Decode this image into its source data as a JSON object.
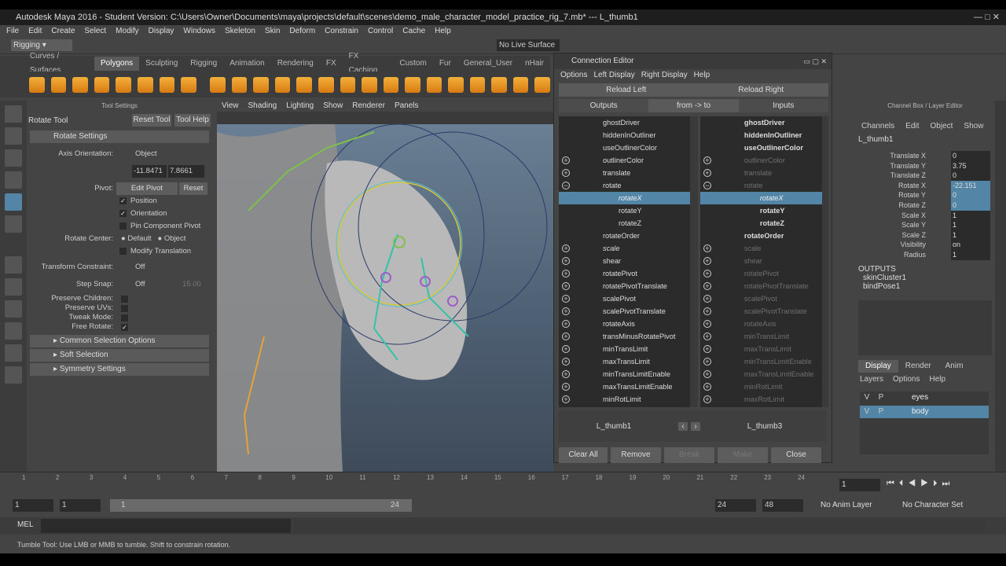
{
  "window": {
    "title": "Autodesk Maya 2016 - Student Version: C:\\Users\\Owner\\Documents\\maya\\projects\\default\\scenes\\demo_male_character_model_practice_rig_7.mb*   ---   L_thumb1"
  },
  "menus": [
    "File",
    "Edit",
    "Create",
    "Select",
    "Modify",
    "Display",
    "Windows",
    "Skeleton",
    "Skin",
    "Deform",
    "Constrain",
    "Control",
    "Cache",
    "Help"
  ],
  "status": {
    "mode": "Rigging",
    "live_surface": "No Live Surface"
  },
  "shelf_tabs": [
    "Curves / Surfaces",
    "Polygons",
    "Sculpting",
    "Rigging",
    "Animation",
    "Rendering",
    "FX",
    "FX Caching",
    "Custom",
    "Fur",
    "General_User",
    "nHair"
  ],
  "shelf_active": "Polygons",
  "tool_settings": {
    "header": "Tool Settings",
    "tool_name": "Rotate Tool",
    "reset": "Reset Tool",
    "help": "Tool Help",
    "section_rotate": "Rotate Settings",
    "axis_orientation_label": "Axis Orientation:",
    "axis_orientation": "Object",
    "val1": "-11.8471",
    "val2": "7.8661",
    "pivot_label": "Pivot:",
    "edit_pivot": "Edit Pivot",
    "reset_pivot": "Reset",
    "position": "Position",
    "orientation": "Orientation",
    "pin": "Pin Component Pivot",
    "rotate_center_label": "Rotate Center:",
    "rc_default": "Default",
    "rc_object": "Object",
    "modify_translation": "Modify Translation",
    "transform_constraint_label": "Transform Constraint:",
    "transform_constraint": "Off",
    "step_snap_label": "Step Snap:",
    "step_snap": "Off",
    "step_value": "15.00",
    "preserve_children": "Preserve Children:",
    "preserve_uvs": "Preserve UVs:",
    "tweak_mode": "Tweak Mode:",
    "free_rotate": "Free Rotate:",
    "sections": [
      "Common Selection Options",
      "Soft Selection",
      "Symmetry Settings"
    ]
  },
  "viewport": {
    "menus": [
      "View",
      "Shading",
      "Lighting",
      "Show",
      "Renderer",
      "Panels"
    ]
  },
  "connection_editor": {
    "title": "Connection Editor",
    "menus": [
      "Options",
      "Left Display",
      "Right Display",
      "Help"
    ],
    "reload_left": "Reload Left",
    "reload_right": "Reload Right",
    "outputs": "Outputs",
    "direction": "from -> to",
    "inputs": "Inputs",
    "left": [
      {
        "label": "ghostDriver",
        "indent": 1,
        "style": ""
      },
      {
        "label": "hiddenInOutliner",
        "indent": 1,
        "style": ""
      },
      {
        "label": "useOutlinerColor",
        "indent": 1,
        "style": ""
      },
      {
        "label": "outlinerColor",
        "indent": 1,
        "style": "",
        "icon": "+"
      },
      {
        "label": "translate",
        "indent": 1,
        "style": "",
        "icon": "+"
      },
      {
        "label": "rotate",
        "indent": 1,
        "style": "",
        "icon": "-"
      },
      {
        "label": "rotateX",
        "indent": 2,
        "style": "sel"
      },
      {
        "label": "rotateY",
        "indent": 2,
        "style": ""
      },
      {
        "label": "rotateZ",
        "indent": 2,
        "style": ""
      },
      {
        "label": "rotateOrder",
        "indent": 1,
        "style": ""
      },
      {
        "label": "scale",
        "indent": 1,
        "style": "it",
        "icon": "+"
      },
      {
        "label": "shear",
        "indent": 1,
        "style": "",
        "icon": "+"
      },
      {
        "label": "rotatePivot",
        "indent": 1,
        "style": "",
        "icon": "+"
      },
      {
        "label": "rotatePivotTranslate",
        "indent": 1,
        "style": "",
        "icon": "+"
      },
      {
        "label": "scalePivot",
        "indent": 1,
        "style": "",
        "icon": "+"
      },
      {
        "label": "scalePivotTranslate",
        "indent": 1,
        "style": "",
        "icon": "+"
      },
      {
        "label": "rotateAxis",
        "indent": 1,
        "style": "",
        "icon": "+"
      },
      {
        "label": "transMinusRotatePivot",
        "indent": 1,
        "style": "",
        "icon": "+"
      },
      {
        "label": "minTransLimit",
        "indent": 1,
        "style": "",
        "icon": "+"
      },
      {
        "label": "maxTransLimit",
        "indent": 1,
        "style": "",
        "icon": "+"
      },
      {
        "label": "minTransLimitEnable",
        "indent": 1,
        "style": "",
        "icon": "+"
      },
      {
        "label": "maxTransLimitEnable",
        "indent": 1,
        "style": "",
        "icon": "+"
      },
      {
        "label": "minRotLimit",
        "indent": 1,
        "style": "",
        "icon": "+"
      }
    ],
    "right": [
      {
        "label": "ghostDriver",
        "indent": 1,
        "style": "b"
      },
      {
        "label": "hiddenInOutliner",
        "indent": 1,
        "style": "b"
      },
      {
        "label": "useOutlinerColor",
        "indent": 1,
        "style": "b"
      },
      {
        "label": "outlinerColor",
        "indent": 1,
        "style": "dim",
        "icon": "+"
      },
      {
        "label": "translate",
        "indent": 1,
        "style": "dim",
        "icon": "+"
      },
      {
        "label": "rotate",
        "indent": 1,
        "style": "dim",
        "icon": "-"
      },
      {
        "label": "rotateX",
        "indent": 2,
        "style": "sel"
      },
      {
        "label": "rotateY",
        "indent": 2,
        "style": "b"
      },
      {
        "label": "rotateZ",
        "indent": 2,
        "style": "b"
      },
      {
        "label": "rotateOrder",
        "indent": 1,
        "style": "b"
      },
      {
        "label": "scale",
        "indent": 1,
        "style": "dim",
        "icon": "+"
      },
      {
        "label": "shear",
        "indent": 1,
        "style": "dim",
        "icon": "+"
      },
      {
        "label": "rotatePivot",
        "indent": 1,
        "style": "dim",
        "icon": "+"
      },
      {
        "label": "rotatePivotTranslate",
        "indent": 1,
        "style": "dim",
        "icon": "+"
      },
      {
        "label": "scalePivot",
        "indent": 1,
        "style": "dim",
        "icon": "+"
      },
      {
        "label": "scalePivotTranslate",
        "indent": 1,
        "style": "dim",
        "icon": "+"
      },
      {
        "label": "rotateAxis",
        "indent": 1,
        "style": "dim",
        "icon": "+"
      },
      {
        "label": "minTransLimit",
        "indent": 1,
        "style": "dim",
        "icon": "+"
      },
      {
        "label": "maxTransLimit",
        "indent": 1,
        "style": "dim",
        "icon": "+"
      },
      {
        "label": "minTransLimitEnable",
        "indent": 1,
        "style": "dim",
        "icon": "+"
      },
      {
        "label": "maxTransLimitEnable",
        "indent": 1,
        "style": "dim",
        "icon": "+"
      },
      {
        "label": "minRotLimit",
        "indent": 1,
        "style": "dim",
        "icon": "+"
      },
      {
        "label": "maxRotLimit",
        "indent": 1,
        "style": "dim",
        "icon": "+"
      }
    ],
    "left_node": "L_thumb1",
    "right_node": "L_thumb3",
    "buttons": {
      "clear": "Clear All",
      "remove": "Remove",
      "break": "Break",
      "make": "Make",
      "close": "Close"
    }
  },
  "channel_box": {
    "header": "Channel Box / Layer Editor",
    "menus": [
      "Channels",
      "Edit",
      "Object",
      "Show"
    ],
    "object": "L_thumb1",
    "attrs": [
      {
        "k": "Translate X",
        "v": "0",
        "hl": false
      },
      {
        "k": "Translate Y",
        "v": "3.75",
        "hl": false
      },
      {
        "k": "Translate Z",
        "v": "0",
        "hl": false
      },
      {
        "k": "Rotate X",
        "v": "-22.151",
        "hl": true
      },
      {
        "k": "Rotate Y",
        "v": "0",
        "hl": true
      },
      {
        "k": "Rotate Z",
        "v": "0",
        "hl": true
      },
      {
        "k": "Scale X",
        "v": "1",
        "hl": false
      },
      {
        "k": "Scale Y",
        "v": "1",
        "hl": false
      },
      {
        "k": "Scale Z",
        "v": "1",
        "hl": false
      },
      {
        "k": "Visibility",
        "v": "on",
        "hl": false
      },
      {
        "k": "Radius",
        "v": "1",
        "hl": false
      }
    ],
    "outputs_label": "OUTPUTS",
    "outputs": [
      "skinCluster1",
      "bindPose1"
    ],
    "tabs": [
      "Display",
      "Render",
      "Anim"
    ],
    "layer_menus": [
      "Layers",
      "Options",
      "Help"
    ],
    "layers": [
      {
        "v": "V",
        "p": "P",
        "name": "eyes",
        "sel": false
      },
      {
        "v": "V",
        "p": "P",
        "name": "body",
        "sel": true
      }
    ]
  },
  "timeline": {
    "ticks": [
      "1",
      "2",
      "3",
      "4",
      "5",
      "6",
      "7",
      "8",
      "9",
      "10",
      "11",
      "12",
      "13",
      "14",
      "15",
      "16",
      "17",
      "18",
      "19",
      "20",
      "21",
      "22",
      "23",
      "24"
    ],
    "current": "1"
  },
  "range": {
    "start": "1",
    "start2": "1",
    "inner_start": "1",
    "inner_end": "24",
    "end": "24",
    "end2": "48",
    "anim_layer": "No Anim Layer",
    "char_set": "No Character Set"
  },
  "mel": "MEL",
  "help_line": "Tumble Tool: Use LMB or MMB to tumble. Shift to constrain rotation."
}
